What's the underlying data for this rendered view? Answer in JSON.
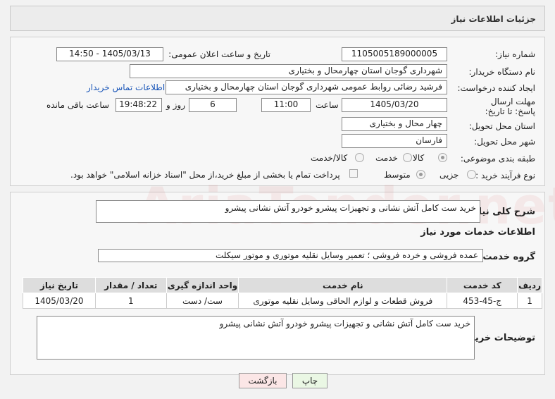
{
  "header": {
    "title": "جزئیات اطلاعات نیاز"
  },
  "fields": {
    "need_number_label": "شماره نیاز:",
    "need_number": "1105005189000005",
    "announce_label": "تاریخ و ساعت اعلان عمومی:",
    "announce_value": "1405/03/13 - 14:50",
    "buyer_org_label": "نام دستگاه خریدار:",
    "buyer_org": "شهرداری گوجان استان چهارمحال و بختیاری",
    "creator_label": "ایجاد کننده درخواست:",
    "creator": "فرشید رضائی روابط عمومی شهرداری گوجان استان چهارمحال و بختیاری",
    "contact_link": "اطلاعات تماس خریدار",
    "deadline_label": "مهلت ارسال پاسخ: تا تاریخ:",
    "deadline_date": "1405/03/20",
    "time_label": "ساعت",
    "deadline_time": "11:00",
    "days": "6",
    "days_label": "روز و",
    "remaining_time": "19:48:22",
    "remaining_label": "ساعت باقی مانده",
    "province_label": "استان محل تحویل:",
    "province": "چهار محال و بختیاری",
    "city_label": "شهر محل تحویل:",
    "city": "فارسان",
    "category_label": "طبقه بندی موضوعی:",
    "category_options": [
      "کالا",
      "خدمت",
      "کالا/خدمت"
    ],
    "process_label": "نوع فرآیند خرید :",
    "process_options": [
      "جزیی",
      "متوسط"
    ],
    "treasury_note": "پرداخت تمام یا بخشی از مبلغ خرید،از محل \"اسناد خزانه اسلامی\" خواهد بود."
  },
  "summary": {
    "label": "شرح کلی نیاز:",
    "text": "خرید ست کامل آتش نشانی و تجهیزات پیشرو خودرو آتش نشانی پیشرو",
    "services_title": "اطلاعات خدمات مورد نیاز",
    "group_label": "گروه خدمت:",
    "group_value": "عمده فروشی و خرده فروشی ؛ تعمیر وسایل نقلیه موتوری و موتور سیکلت"
  },
  "table": {
    "headers": [
      "ردیف",
      "کد خدمت",
      "نام خدمت",
      "واحد اندازه گیری",
      "تعداد / مقدار",
      "تاریخ نیاز"
    ],
    "rows": [
      [
        "1",
        "ج-45-453",
        "فروش قطعات و لوازم الحاقی وسایل نقلیه موتوری",
        "ست/ دست",
        "1",
        "1405/03/20"
      ]
    ]
  },
  "buyer_notes": {
    "label": "توضیحات خریدار:",
    "text": "خرید ست کامل آتش نشانی و تجهیزات پیشرو خودرو آتش نشانی پیشرو"
  },
  "buttons": {
    "print": "چاپ",
    "back": "بازگشت"
  },
  "watermark": "AriaTender.net"
}
